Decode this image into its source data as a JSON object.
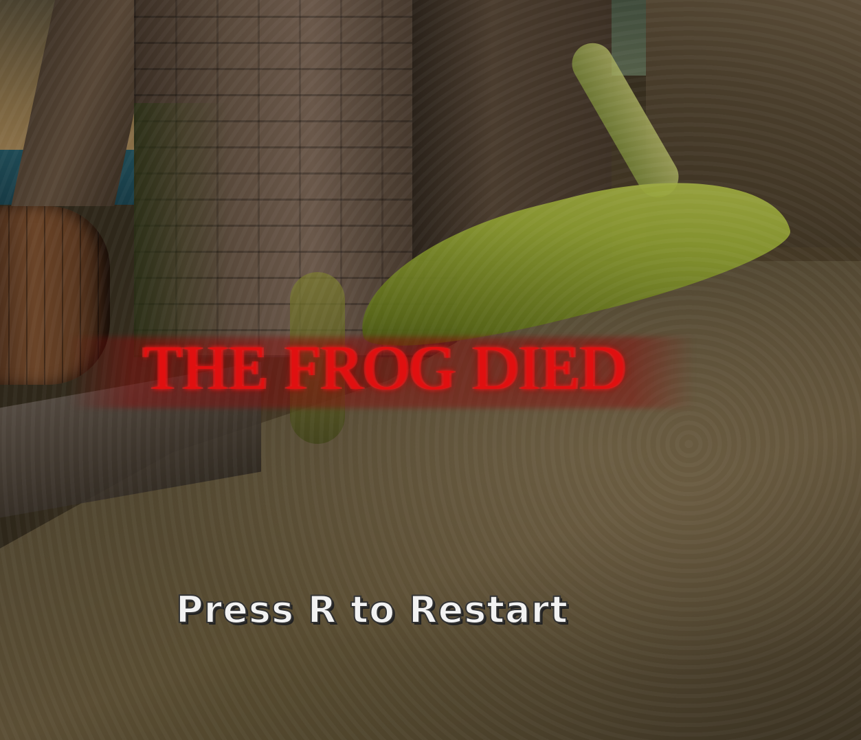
{
  "game": {
    "death_message": "THE FROG DIED",
    "restart_prompt": "Press R to Restart"
  },
  "colors": {
    "death_text": "#e01010",
    "restart_text": "#f2f2f2"
  }
}
